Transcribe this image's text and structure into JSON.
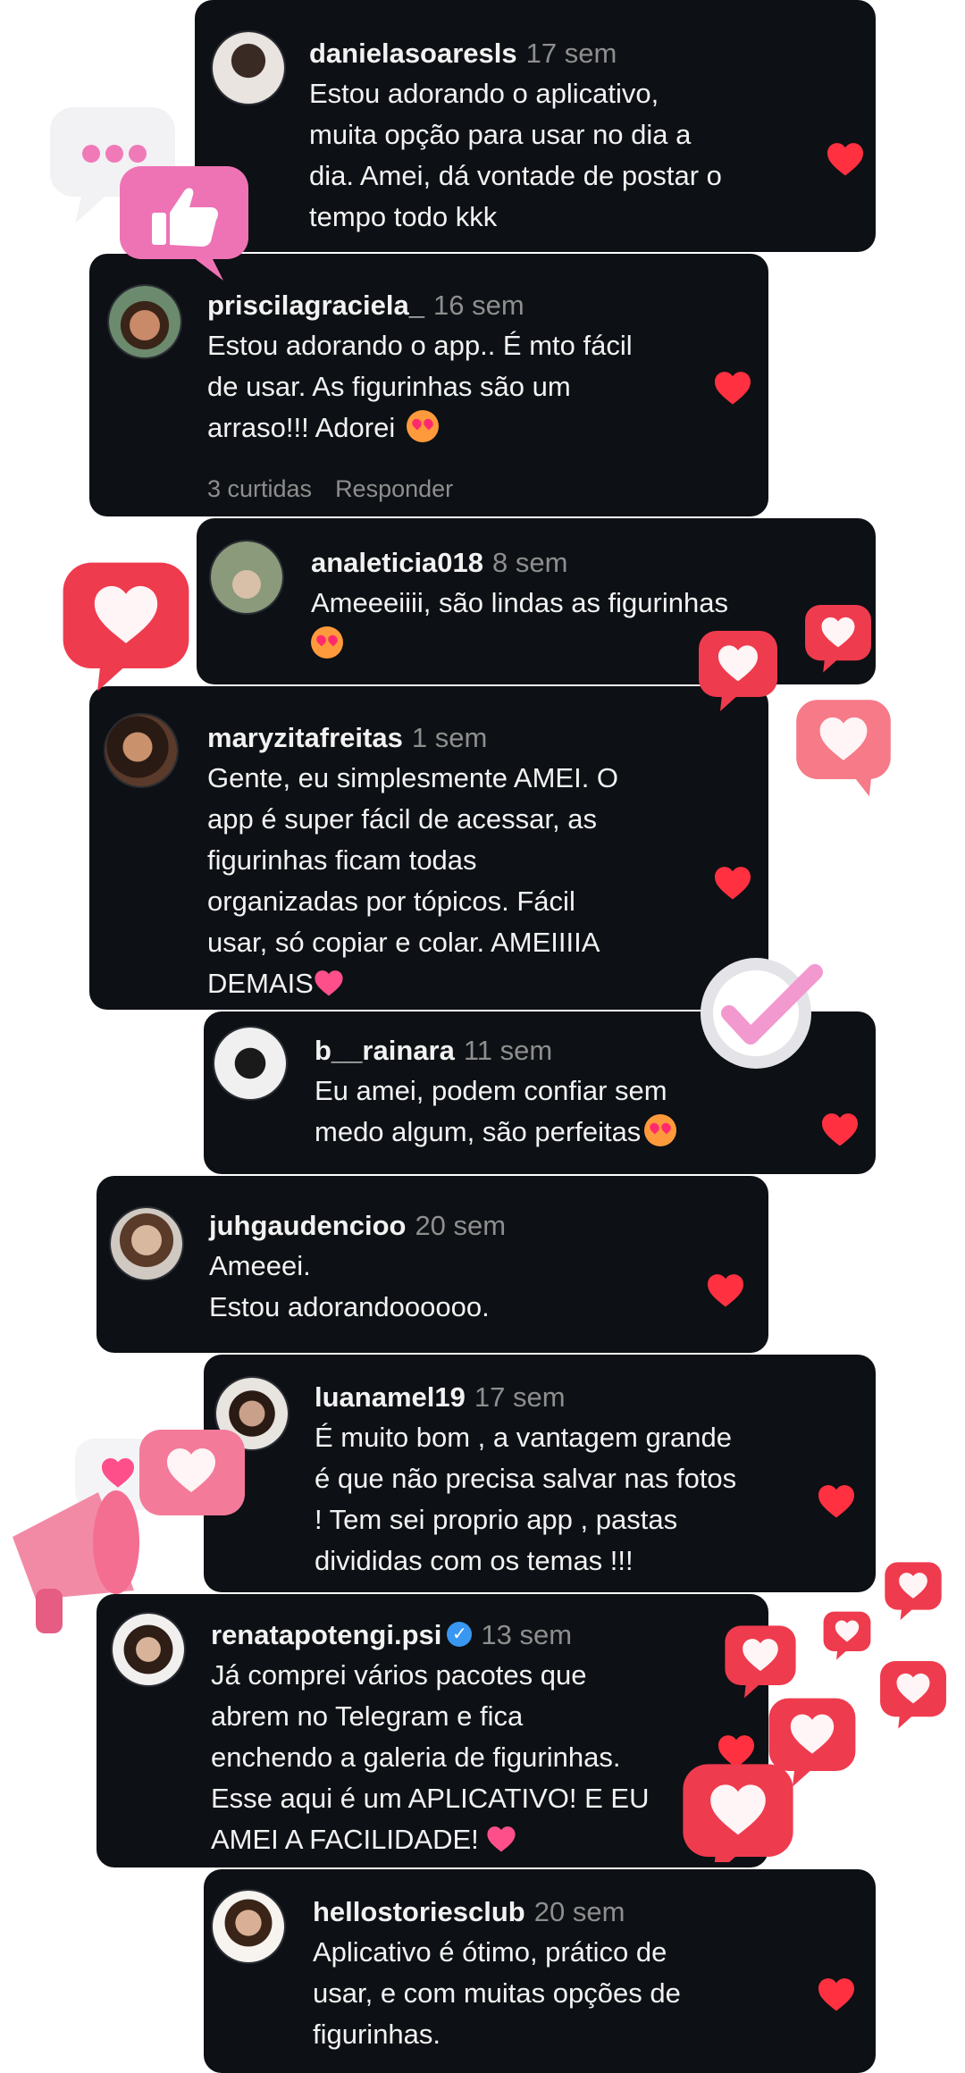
{
  "comments": [
    {
      "username": "danielasoaresls",
      "time": "17 sem",
      "lines": [
        "Estou adorando o aplicativo,",
        "muita opção para usar no dia a",
        "dia. Amei, dá vontade de postar o",
        "tempo todo kkk"
      ]
    },
    {
      "username": "priscilagraciela_",
      "time": "16 sem",
      "lines": [
        "Estou adorando o app.. É mto fácil",
        "de usar. As figurinhas são um",
        "arraso!!! Adorei"
      ],
      "likes": "3 curtidas",
      "reply": "Responder"
    },
    {
      "username": "analeticia018",
      "time": "8 sem",
      "lines": [
        "Ameeeiiii, são lindas as figurinhas"
      ]
    },
    {
      "username": "maryzitafreitas",
      "time": "1 sem",
      "lines": [
        "Gente, eu simplesmente AMEI. O",
        "app é super fácil de acessar, as",
        "figurinhas ficam todas",
        "organizadas por tópicos. Fácil",
        "usar, só copiar e colar. AMEIIIIA",
        "DEMAIS"
      ]
    },
    {
      "username": "b__rainara",
      "time": "11 sem",
      "lines": [
        "Eu amei, podem confiar sem",
        "medo algum, são perfeitas"
      ]
    },
    {
      "username": "juhgaudencioo",
      "time": "20 sem",
      "lines": [
        "Ameeei.",
        "Estou adorandoooooo."
      ]
    },
    {
      "username": "luanamel19",
      "time": "17 sem",
      "lines": [
        "É muito bom , a vantagem grande",
        "é que não precisa salvar nas fotos",
        "! Tem sei proprio app , pastas",
        "divididas com os temas !!!"
      ]
    },
    {
      "username": "renatapotengi.psi",
      "time": "13 sem",
      "lines": [
        "Já comprei vários pacotes que",
        "abrem no Telegram e fica",
        "enchendo a galeria de figurinhas.",
        "Esse aqui é um APLICATIVO! E EU",
        "AMEI A FACILIDADE!"
      ]
    },
    {
      "username": "hellostoriesclub",
      "time": "20 sem",
      "lines": [
        "Aplicativo é ótimo, prático de",
        "usar, e com muitas opções de",
        "figurinhas."
      ]
    }
  ],
  "icons": {
    "like": "heart-icon",
    "verified": "verified-badge-icon",
    "emoji_heart_eyes": "heart-eyes-emoji-icon",
    "emoji_pink_heart": "pink-heart-emoji-icon"
  },
  "colors": {
    "card_bg": "#0d1014",
    "like_red": "#ff3040",
    "meta_gray": "#8e8e8e",
    "verified_blue": "#3897f0"
  }
}
